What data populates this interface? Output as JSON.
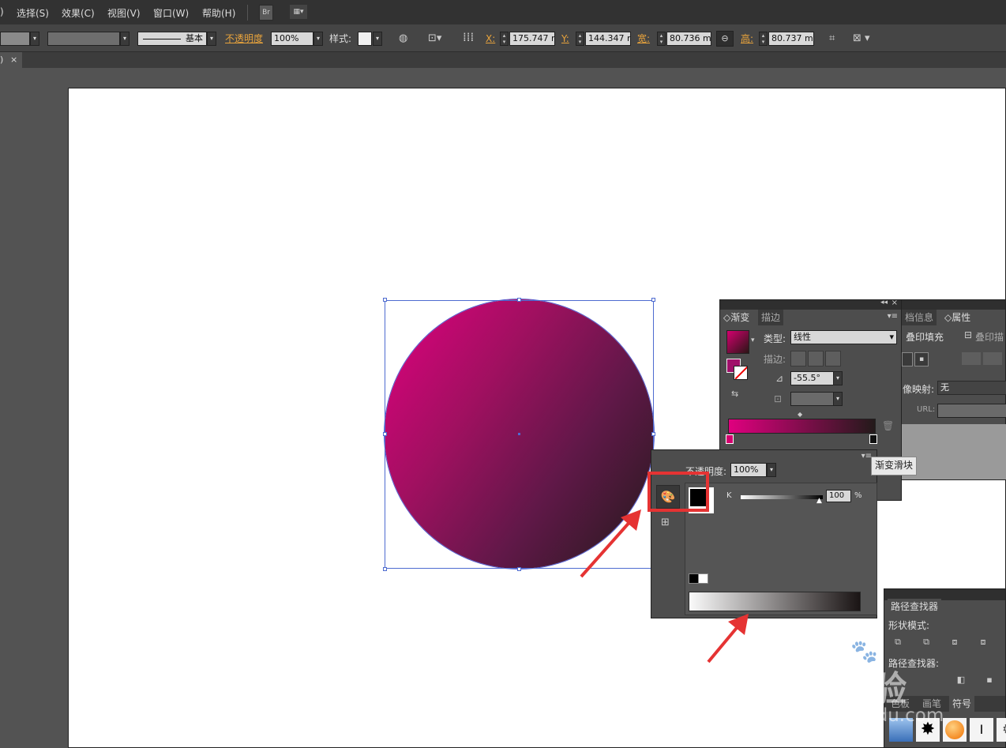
{
  "menubar": {
    "items": [
      ")",
      "选择(S)",
      "效果(C)",
      "视图(V)",
      "窗口(W)",
      "帮助(H)"
    ],
    "bridge_label": "Br"
  },
  "control_bar": {
    "stroke_style": "基本",
    "opacity_label": "不透明度",
    "opacity_value": "100%",
    "style_label": "样式:",
    "x_label": "X:",
    "x_value": "175.747 r",
    "y_label": "Y:",
    "y_value": "144.347 r",
    "w_label": "宽:",
    "w_value": "80.736 mi",
    "h_label": "高:",
    "h_value": "80.737 mi"
  },
  "doc_tab": {
    "label": ")",
    "close": "×"
  },
  "gradient_panel": {
    "tab_gradient": "渐变",
    "tab_stroke": "描边",
    "type_label": "类型:",
    "type_value": "线性",
    "stroke_label": "描边:",
    "angle_value": "-55.5°",
    "collapse": "◂◂",
    "close": "×"
  },
  "side_panel": {
    "tab_docinfo": "档信息",
    "tab_attributes": "属性",
    "overprint_fill": "叠印填充",
    "overprint_stroke": "叠印描",
    "image_map_label": "像映射:",
    "image_map_value": "无",
    "url_label": "URL:"
  },
  "tooltip": {
    "text": "渐变滑块"
  },
  "color_popup": {
    "opacity_label": "不透明度:",
    "opacity_value": "100%",
    "k_label": "K",
    "k_value": "100",
    "percent": "%"
  },
  "pathfinder_panel": {
    "title": "路径查找器",
    "shape_modes": "形状模式:",
    "pathfinders": "路径查找器:",
    "tab_swatches": "色板",
    "tab_brushes": "画笔",
    "tab_symbols": "符号"
  },
  "watermark": {
    "logo": "Bai经验",
    "url": "jingyan.baidu.com"
  },
  "colors": {
    "menubar_bg": "#323232",
    "panel_bg": "#4d4d4d",
    "gradient_start": "#e0007f",
    "gradient_end": "#231a1a",
    "accent_orange": "#e8a33c",
    "annotation_red": "#e53333",
    "selection_blue": "#4e6bd0"
  }
}
